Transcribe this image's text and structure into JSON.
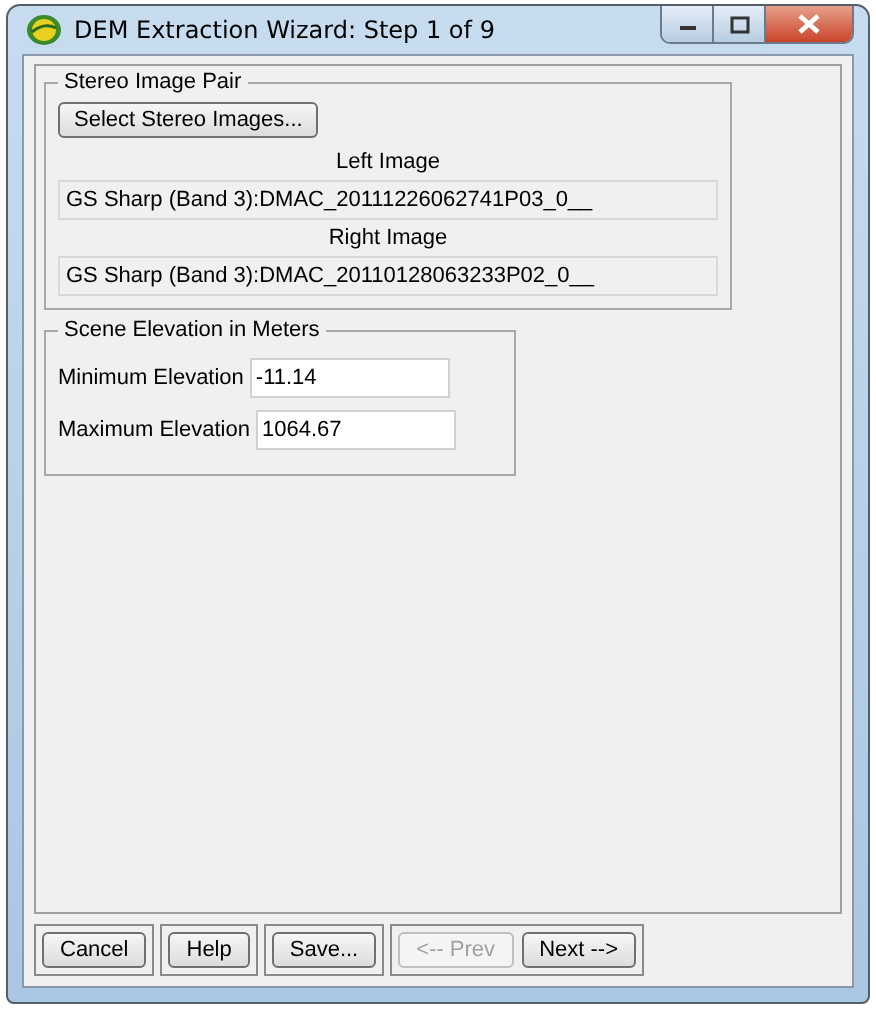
{
  "window": {
    "title": "DEM Extraction Wizard: Step 1 of 9"
  },
  "stereo_group": {
    "title": "Stereo Image Pair",
    "select_button": "Select Stereo Images...",
    "images": [
      {
        "label": "Left Image",
        "value": "GS Sharp (Band 3):DMAC_20111226062741P03_0__"
      },
      {
        "label": "Right Image",
        "value": "GS Sharp (Band 3):DMAC_20110128063233P02_0__"
      }
    ]
  },
  "elevation_group": {
    "title": "Scene Elevation in Meters",
    "fields": [
      {
        "label": "Minimum Elevation",
        "value": "-11.14"
      },
      {
        "label": "Maximum Elevation",
        "value": "1064.67"
      }
    ]
  },
  "button_groups": [
    [
      {
        "label": "Cancel",
        "disabled": false
      }
    ],
    [
      {
        "label": "Help",
        "disabled": false
      }
    ],
    [
      {
        "label": "Save...",
        "disabled": false
      }
    ],
    [
      {
        "label": "<-- Prev",
        "disabled": true
      },
      {
        "label": "Next -->",
        "disabled": false
      }
    ]
  ]
}
